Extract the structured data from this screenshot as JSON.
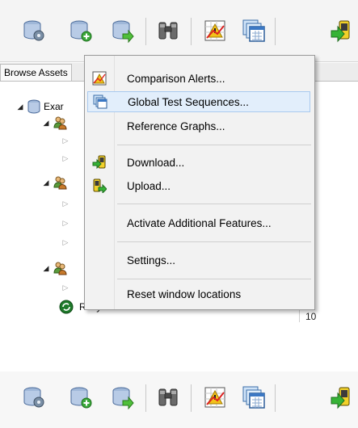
{
  "toolbar": {
    "buttons": [
      {
        "icon": "database-settings-icon"
      },
      {
        "icon": "database-add-icon"
      },
      {
        "icon": "database-export-icon"
      },
      {
        "icon": "binoculars-icon"
      },
      {
        "icon": "comparison-alerts-icon"
      },
      {
        "icon": "global-test-sequences-icon"
      },
      {
        "icon": "download-icon"
      }
    ]
  },
  "panel": {
    "tab_label": "Browse Assets",
    "tree": {
      "root_label": "Exar",
      "recycled_label": "Recycled"
    },
    "column_value": "10"
  },
  "menu": {
    "items": [
      {
        "label": "Comparison Alerts...",
        "icon": "comparison-alerts-icon",
        "selected": false
      },
      {
        "label": "Global Test Sequences...",
        "icon": "global-test-sequences-icon",
        "selected": true
      },
      {
        "label": "Reference Graphs...",
        "icon": "",
        "selected": false
      },
      {
        "label": "Download...",
        "icon": "download-icon",
        "selected": false
      },
      {
        "label": "Upload...",
        "icon": "upload-icon",
        "selected": false
      },
      {
        "label": "Activate Additional Features...",
        "icon": "",
        "selected": false
      },
      {
        "label": "Settings...",
        "icon": "",
        "selected": false
      },
      {
        "label": "Reset window locations",
        "icon": "",
        "selected": false
      }
    ]
  },
  "colors": {
    "menu_bg": "#f2f2f2",
    "highlight_bg": "#e2eefb",
    "highlight_border": "#a9c9ef",
    "toolbar_bg": "#f4f4f4"
  }
}
